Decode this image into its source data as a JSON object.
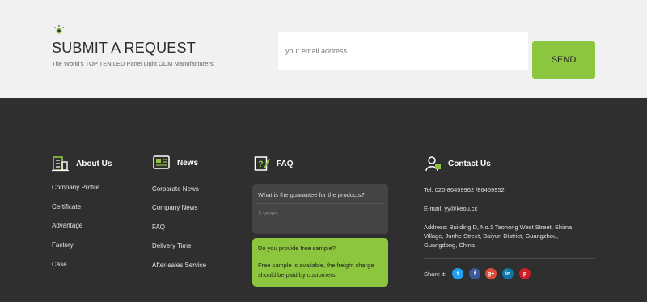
{
  "request": {
    "title": "SUBMIT A REQUEST",
    "subtitle": "The World's TOP TEN LED Panel Light ODM Manufacturers.",
    "email_placeholder": "your email address ...",
    "send_label": "SEND"
  },
  "about": {
    "title": "About Us",
    "links": [
      "Company Profile",
      "Certificate",
      "Advantage",
      "Factory",
      "Case"
    ]
  },
  "news": {
    "title": "News",
    "links": [
      "Corporate News",
      "Company News",
      "FAQ",
      "Delivery Time",
      "After-sales Service"
    ]
  },
  "faq": {
    "title": "FAQ",
    "items": [
      {
        "question": "What is the guarantee for the products?",
        "answer": "3 years"
      },
      {
        "question": "Do you provide free sample?",
        "answer": "Free sample is available, the freight charge should be paid by customers."
      }
    ]
  },
  "contact": {
    "title": "Contact Us",
    "tel": "Tel: 020-86459962 /86459952",
    "email": "E-mail: yy@keou.cc",
    "address": "Address: Building D, No.1 Taohong West Street, Shima Village, Junhe Street, Baiyun District, Guangzhou, Guangdong, China",
    "share_label": "Share it:",
    "social": [
      {
        "name": "twitter",
        "glyph": "t",
        "color": "#1da1f2"
      },
      {
        "name": "facebook",
        "glyph": "f",
        "color": "#3b5998"
      },
      {
        "name": "google-plus",
        "glyph": "g+",
        "color": "#dd4b39"
      },
      {
        "name": "linkedin",
        "glyph": "in",
        "color": "#0e76a8"
      },
      {
        "name": "pinterest",
        "glyph": "p",
        "color": "#cb2027"
      }
    ]
  },
  "colors": {
    "accent": "#8cc63f",
    "footer_bg": "#2f2f2f",
    "band_bg": "#f1f1f1"
  }
}
